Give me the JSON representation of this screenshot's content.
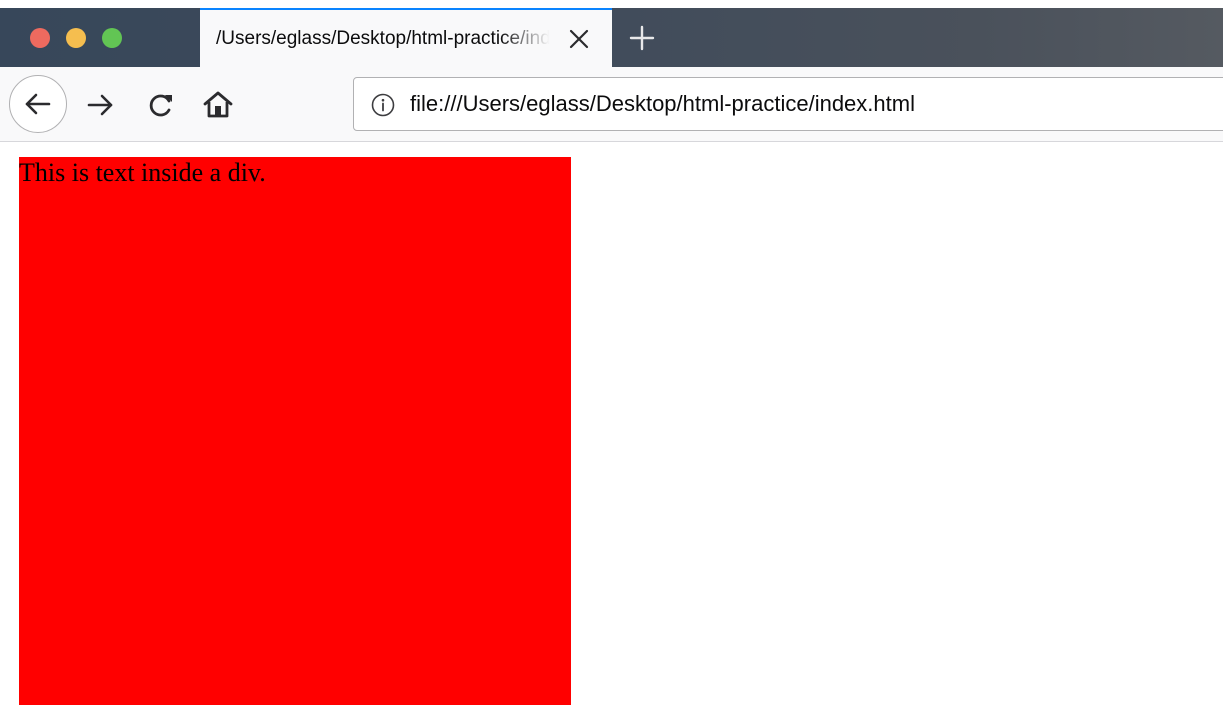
{
  "colors": {
    "traffic_close": "#ee6a5f",
    "traffic_minimize": "#f5be4f",
    "traffic_maximize": "#62c554",
    "tab_accent": "#0a84ff",
    "div_background": "#ff0000"
  },
  "window_controls": {
    "close_icon": "close-circle",
    "minimize_icon": "minimize-circle",
    "maximize_icon": "maximize-circle"
  },
  "tabs": [
    {
      "title": "/Users/eglass/Desktop/html-practice/index.html",
      "close_icon": "close-icon",
      "active": true
    }
  ],
  "toolbar": {
    "back_icon": "arrow-left-icon",
    "forward_icon": "arrow-right-icon",
    "reload_icon": "reload-icon",
    "home_icon": "home-icon",
    "new_tab_icon": "plus-icon"
  },
  "address_bar": {
    "info_icon": "info-icon",
    "url": "file:///Users/eglass/Desktop/html-practice/index.html"
  },
  "page": {
    "div_text": "This is text inside a div."
  }
}
